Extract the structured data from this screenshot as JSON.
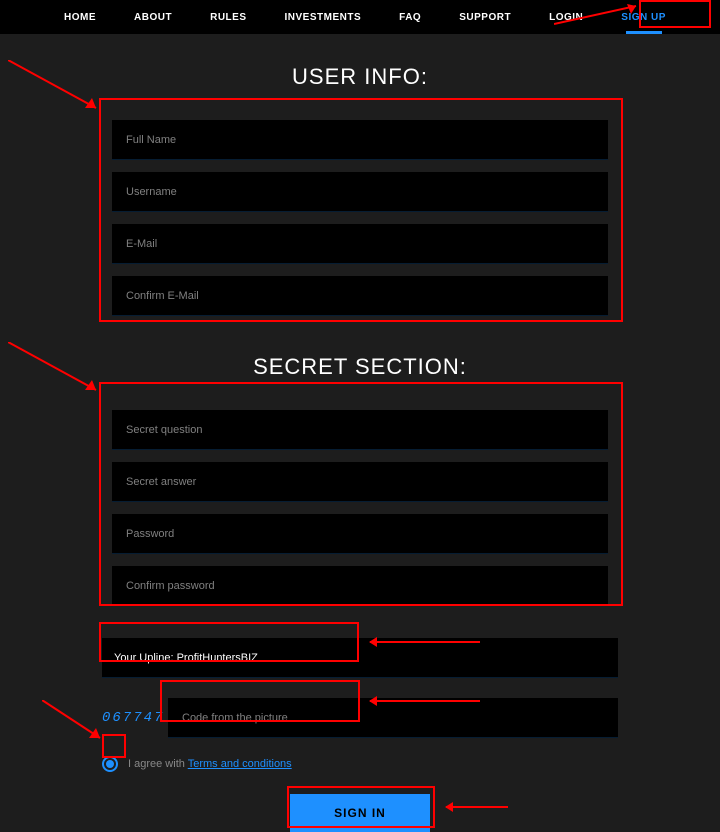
{
  "nav": {
    "home": "HOME",
    "about": "ABOUT",
    "rules": "RULES",
    "investments": "INVESTMENTS",
    "faq": "FAQ",
    "support": "SUPPORT",
    "login": "LOGIN",
    "signup": "SIGN UP"
  },
  "headings": {
    "user_info": "USER INFO:",
    "secret_section": "SECRET SECTION:"
  },
  "placeholders": {
    "full_name": "Full Name",
    "username": "Username",
    "email": "E-Mail",
    "confirm_email": "Confirm E-Mail",
    "secret_question": "Secret question",
    "secret_answer": "Secret answer",
    "password": "Password",
    "confirm_password": "Confirm password",
    "captcha": "Code from the picture"
  },
  "upline_text": "Your Upline: ProfitHuntersBIZ",
  "captcha_code": "067747",
  "agree": {
    "prefix": "I agree with ",
    "link": "Terms and conditions"
  },
  "button": {
    "signin": "SIGN IN"
  }
}
